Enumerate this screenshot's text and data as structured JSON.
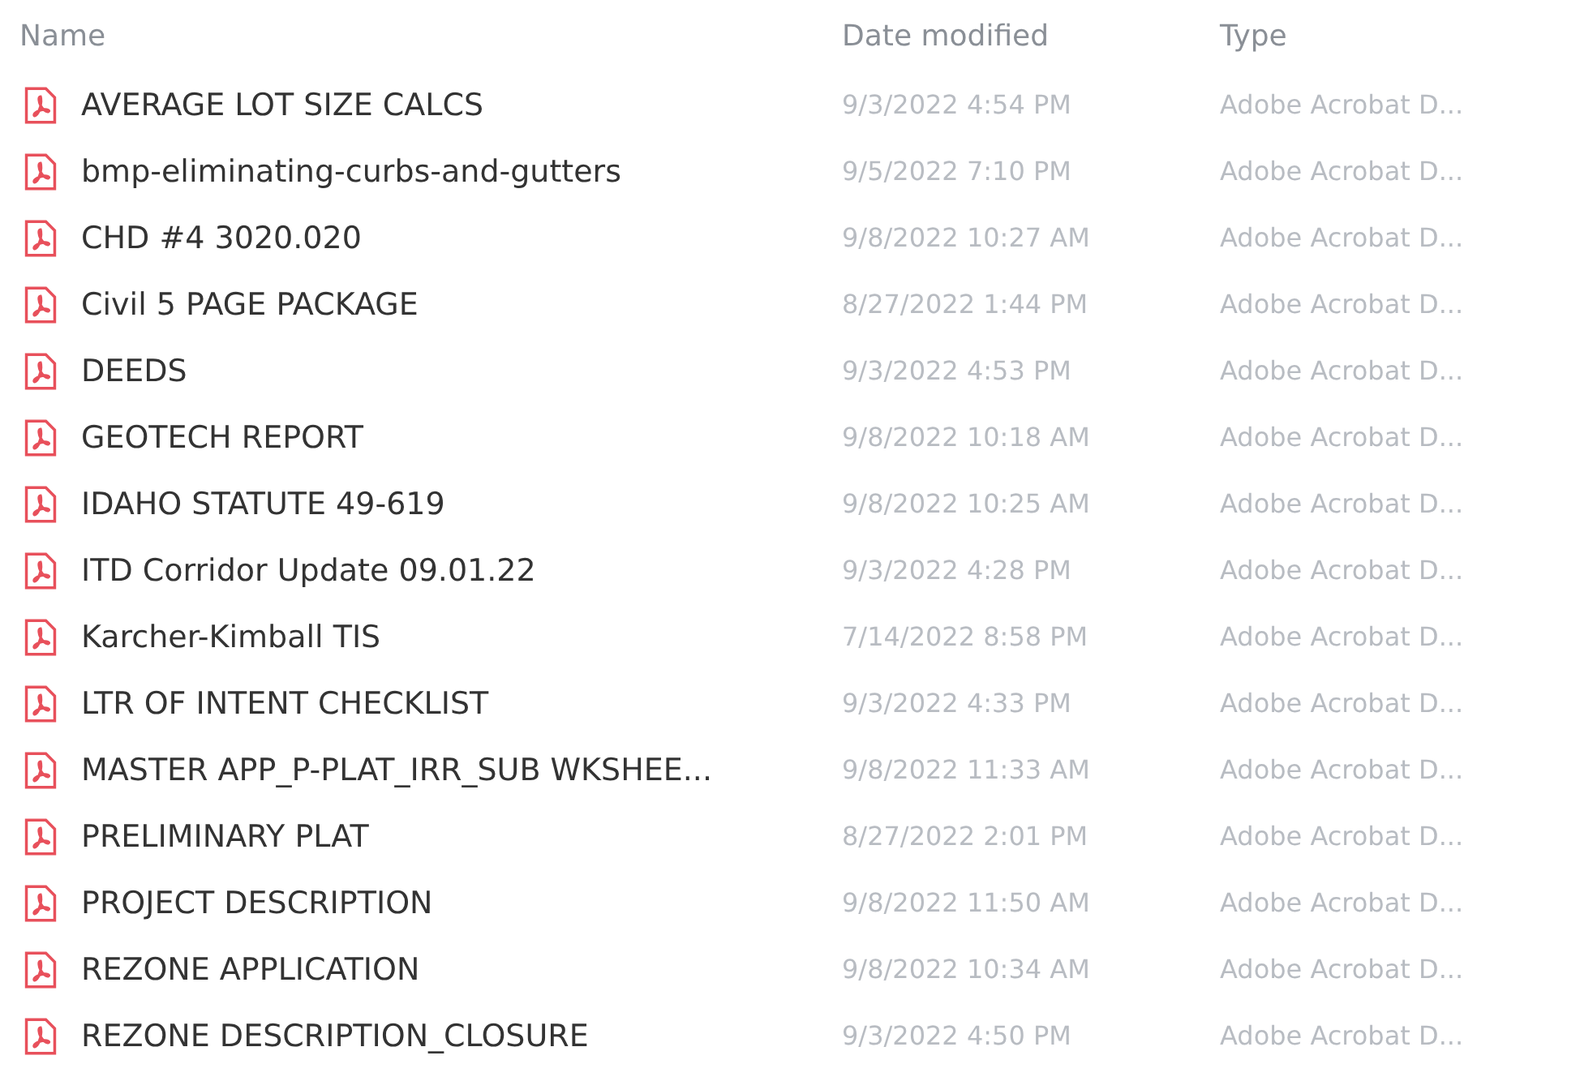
{
  "columns": [
    "Name",
    "Date modified",
    "Type"
  ],
  "files": [
    {
      "name": "AVERAGE LOT SIZE CALCS",
      "date": "9/3/2022 4:54 PM",
      "type": "Adobe Acrobat D..."
    },
    {
      "name": "bmp-eliminating-curbs-and-gutters",
      "date": "9/5/2022 7:10 PM",
      "type": "Adobe Acrobat D..."
    },
    {
      "name": "CHD #4 3020.020",
      "date": "9/8/2022 10:27 AM",
      "type": "Adobe Acrobat D..."
    },
    {
      "name": "Civil 5 PAGE PACKAGE",
      "date": "8/27/2022 1:44 PM",
      "type": "Adobe Acrobat D..."
    },
    {
      "name": "DEEDS",
      "date": "9/3/2022 4:53 PM",
      "type": "Adobe Acrobat D..."
    },
    {
      "name": "GEOTECH REPORT",
      "date": "9/8/2022 10:18 AM",
      "type": "Adobe Acrobat D..."
    },
    {
      "name": "IDAHO STATUTE 49-619",
      "date": "9/8/2022 10:25 AM",
      "type": "Adobe Acrobat D..."
    },
    {
      "name": "ITD Corridor Update 09.01.22",
      "date": "9/3/2022 4:28 PM",
      "type": "Adobe Acrobat D..."
    },
    {
      "name": "Karcher-Kimball TIS",
      "date": "7/14/2022 8:58 PM",
      "type": "Adobe Acrobat D..."
    },
    {
      "name": "LTR OF INTENT CHECKLIST",
      "date": "9/3/2022 4:33 PM",
      "type": "Adobe Acrobat D..."
    },
    {
      "name": "MASTER APP_P-PLAT_IRR_SUB WKSHEE...",
      "date": "9/8/2022 11:33 AM",
      "type": "Adobe Acrobat D..."
    },
    {
      "name": "PRELIMINARY PLAT",
      "date": "8/27/2022 2:01 PM",
      "type": "Adobe Acrobat D..."
    },
    {
      "name": "PROJECT DESCRIPTION",
      "date": "9/8/2022 11:50 AM",
      "type": "Adobe Acrobat D..."
    },
    {
      "name": "REZONE APPLICATION",
      "date": "9/8/2022 10:34 AM",
      "type": "Adobe Acrobat D..."
    },
    {
      "name": "REZONE DESCRIPTION_CLOSURE",
      "date": "9/3/2022 4:50 PM",
      "type": "Adobe Acrobat D..."
    }
  ]
}
